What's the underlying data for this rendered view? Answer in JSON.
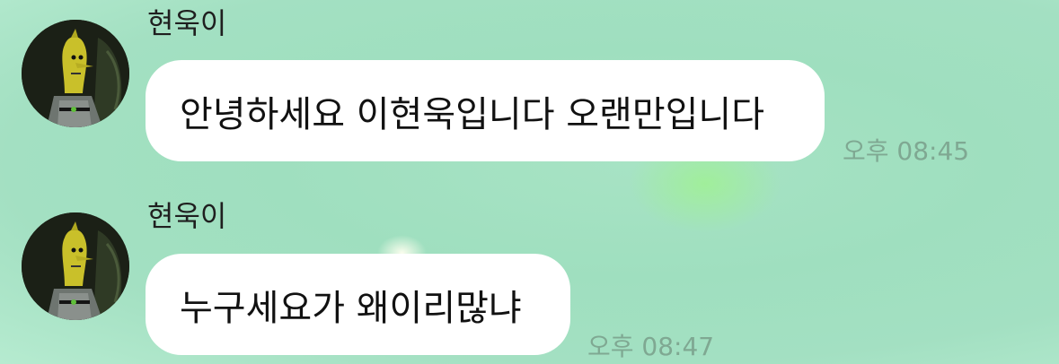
{
  "messages": [
    {
      "sender": "현욱이",
      "text": "안녕하세요 이현욱입니다 오랜만입니다",
      "time": "오후 08:45"
    },
    {
      "sender": "현욱이",
      "text": "누구세요가 왜이리많냐",
      "time": "오후 08:47"
    }
  ],
  "colors": {
    "background": "#a3e0c2",
    "bubble": "#ffffff",
    "time_text": "#7fa892"
  },
  "icons": {
    "avatar": "lemongrab-avatar"
  }
}
